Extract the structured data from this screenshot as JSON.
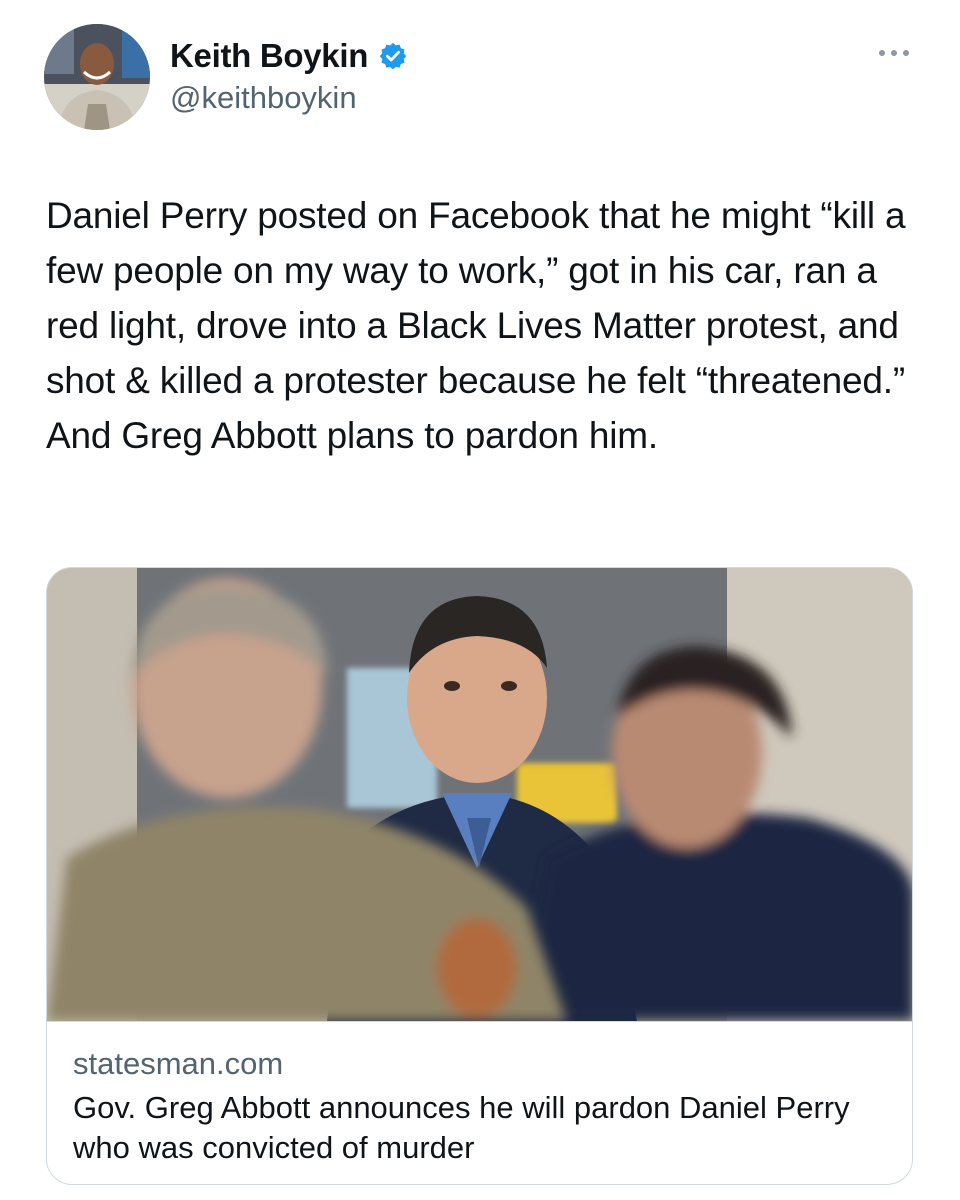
{
  "author": {
    "display_name": "Keith Boykin",
    "handle": "@keithboykin",
    "verified_icon": "verified-badge-icon",
    "verified_color": "#1d9bf0"
  },
  "menu": {
    "more_icon": "more-dots-icon"
  },
  "tweet": {
    "text": "Daniel Perry posted on Facebook that he might “kill a few people on my way to work,” got in his car, ran a red light, drove into a Black Lives Matter protest, and shot & killed a protester because he felt “threatened.” And Greg Abbott plans to pardon him."
  },
  "link_card": {
    "domain": "statesman.com",
    "title": "Gov. Greg Abbott announces he will pardon Daniel Perry who was convicted of murder"
  },
  "colors": {
    "text_primary": "#0f1419",
    "text_secondary": "#536471",
    "border": "#cfd9de",
    "accent": "#1d9bf0"
  }
}
